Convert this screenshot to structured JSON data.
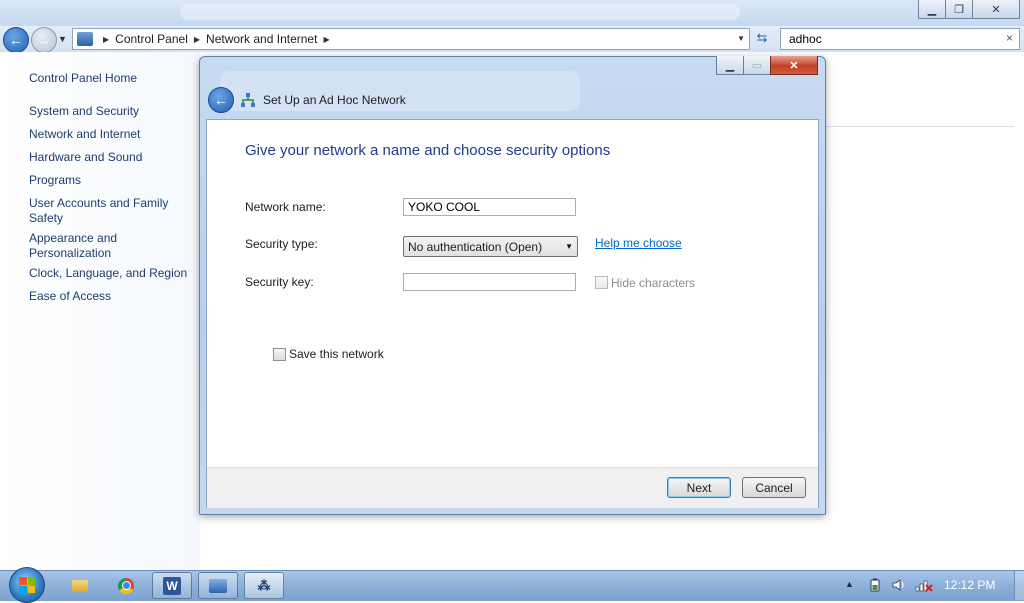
{
  "explorer": {
    "breadcrumb": [
      "Control Panel",
      "Network and Internet"
    ],
    "search_value": "adhoc",
    "clear_label": "×"
  },
  "left_nav": {
    "home": "Control Panel Home",
    "items": [
      "System and Security",
      "Network and Internet",
      "Hardware and Sound",
      "Programs",
      "User Accounts and Family Safety",
      "Appearance and Personalization",
      "Clock, Language, and Region",
      "Ease of Access"
    ]
  },
  "dialog": {
    "title": "Set Up an Ad Hoc Network",
    "heading": "Give your network a name and choose security options",
    "network_name_label": "Network name:",
    "network_name_value": "YOKO COOL",
    "security_type_label": "Security type:",
    "security_type_value": "No authentication (Open)",
    "help_link": "Help me choose",
    "security_key_label": "Security key:",
    "security_key_value": "",
    "hide_characters_label": "Hide characters",
    "save_network_label": "Save this network",
    "next_label": "Next",
    "cancel_label": "Cancel"
  },
  "taskbar": {
    "clock": "12:12 PM",
    "word_letter": "W"
  },
  "colors": {
    "link": "#1e3d6e",
    "heading": "#1e3d8a",
    "help_link": "#0066cc",
    "taskbar": "#8fb1da",
    "close_button": "#c4402a"
  },
  "icons": {
    "back": "back-arrow-icon",
    "forward": "forward-arrow-icon",
    "refresh": "refresh-icon",
    "network": "network-icon",
    "tray": [
      "show-hidden-icons",
      "battery-icon",
      "volume-icon",
      "network-disconnected-icon"
    ]
  }
}
